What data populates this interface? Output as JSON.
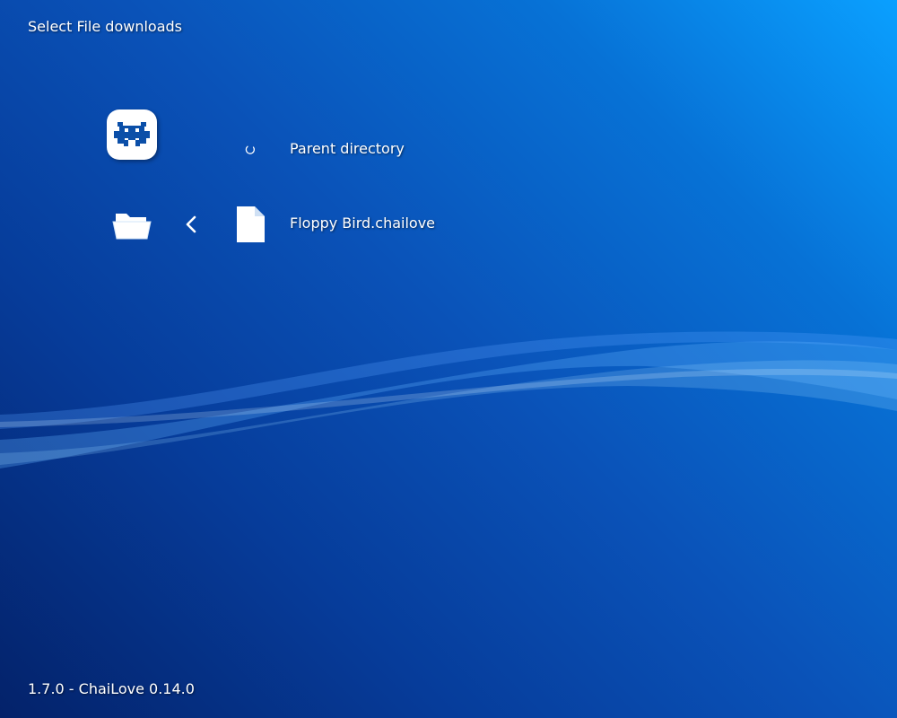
{
  "header": {
    "title": "Select File downloads"
  },
  "sidebar": {
    "logo_icon": "retroarch-logo-icon",
    "active_tab_icon": "folder-open-icon",
    "back_icon": "chevron-left-icon"
  },
  "file_list": {
    "items": [
      {
        "label": "Parent directory",
        "icon": "loading-icon"
      },
      {
        "label": "Floppy Bird.chailove",
        "icon": "file-icon"
      }
    ]
  },
  "footer": {
    "version": "1.7.0 - ChaiLove 0.14.0"
  },
  "colors": {
    "background_light": "#0aa0ff",
    "background_mid": "#0a52b8",
    "background_dark": "#04226a",
    "text": "#ffffff",
    "logo_blue": "#0b4fa8"
  }
}
